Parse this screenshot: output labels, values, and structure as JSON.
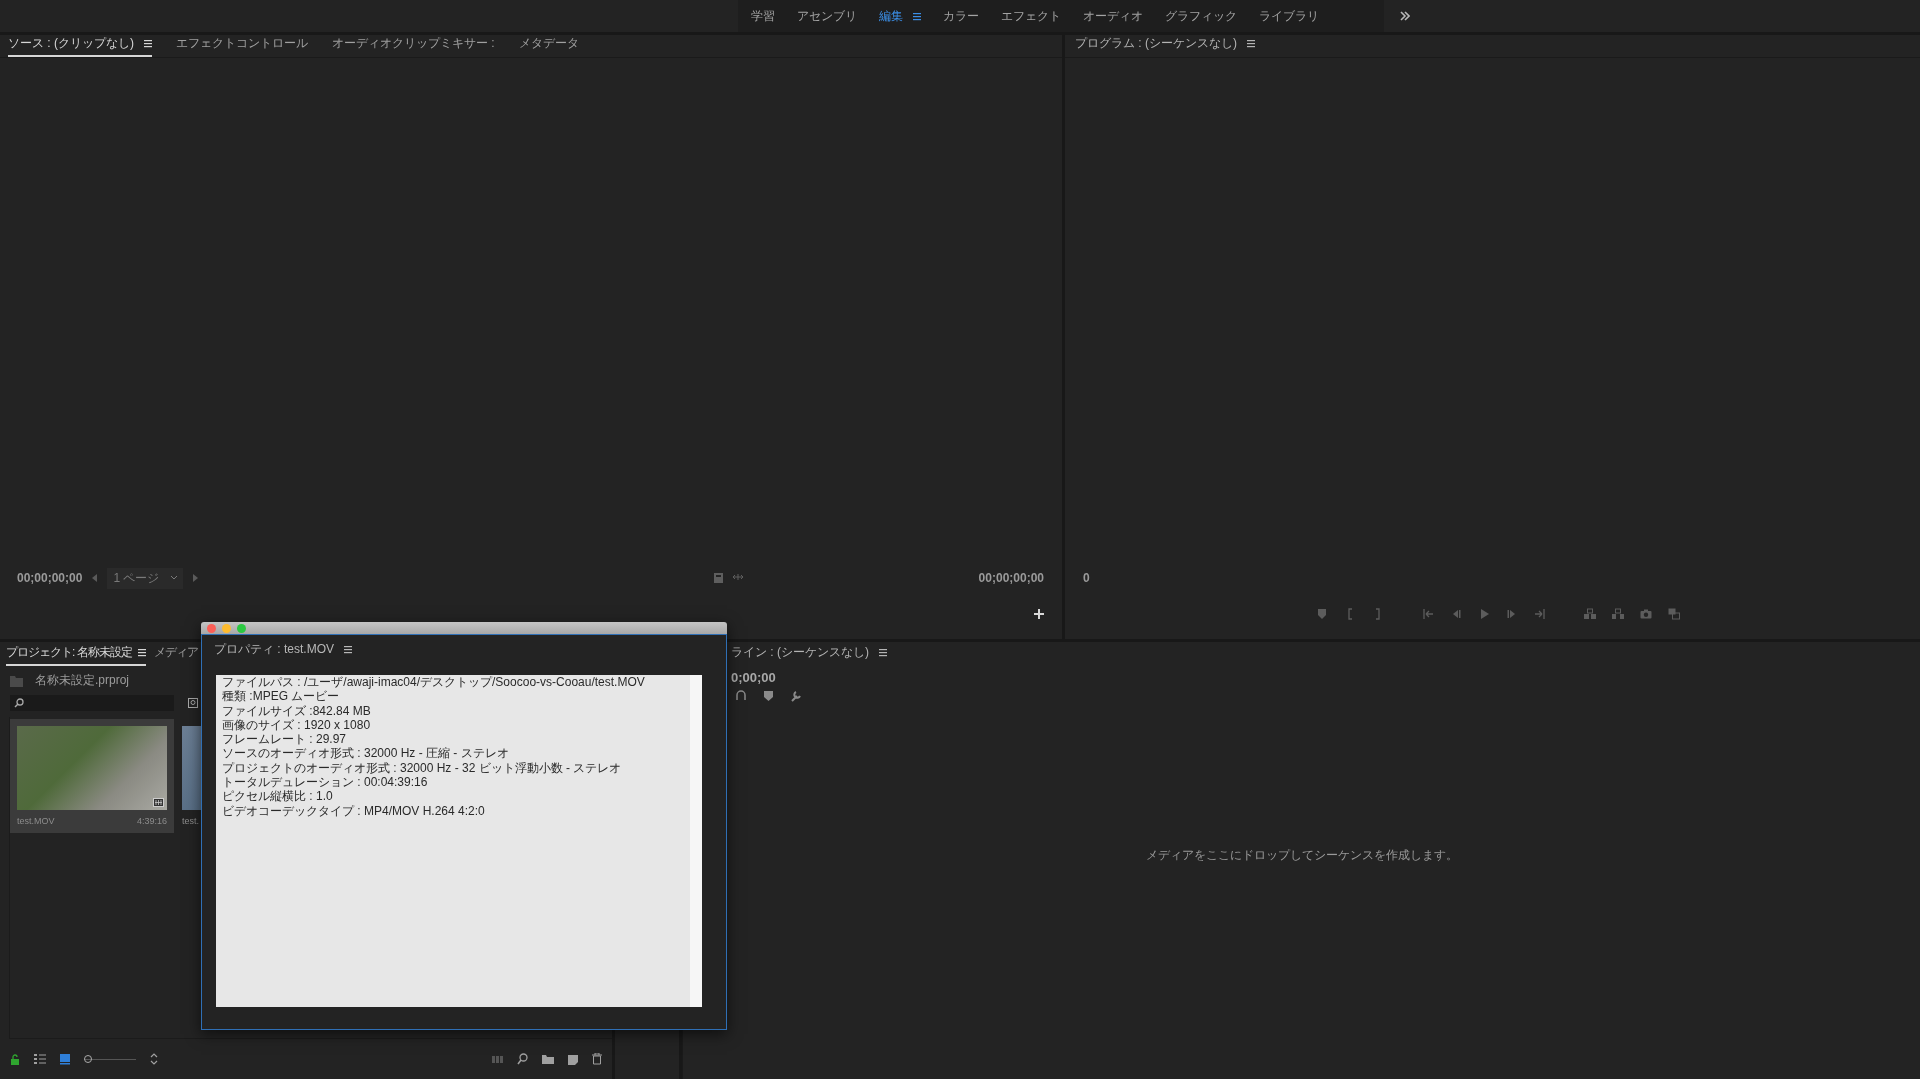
{
  "workspace_bar": {
    "tabs": [
      {
        "label": "学習",
        "selected": false
      },
      {
        "label": "アセンブリ",
        "selected": false
      },
      {
        "label": "編集",
        "selected": true
      },
      {
        "label": "カラー",
        "selected": false
      },
      {
        "label": "エフェクト",
        "selected": false
      },
      {
        "label": "オーディオ",
        "selected": false
      },
      {
        "label": "グラフィック",
        "selected": false
      },
      {
        "label": "ライブラリ",
        "selected": false
      }
    ]
  },
  "source_panel": {
    "tabs": [
      {
        "label": "ソース : (クリップなし)",
        "selected": true
      },
      {
        "label": "エフェクトコントロール",
        "selected": false
      },
      {
        "label": "オーディオクリップミキサー :",
        "selected": false
      },
      {
        "label": "メタデータ",
        "selected": false
      }
    ],
    "timecode_left": "00;00;00;00",
    "page_select": "1 ページ",
    "timecode_right": "00;00;00;00"
  },
  "program_panel": {
    "title": "プログラム : (シーケンスなし)",
    "timecode": "0"
  },
  "project_panel": {
    "tabs": [
      {
        "label": "プロジェクト: 名称未設定",
        "selected": true
      },
      {
        "label": "メディア",
        "selected": false
      }
    ],
    "project_file": "名称未設定.prproj",
    "items": [
      {
        "name": "test.MOV",
        "duration": "4:39:16",
        "selected": true
      },
      {
        "name": "test.",
        "selected": false
      }
    ],
    "thumbnail_zoom": {
      "level": 0
    }
  },
  "timeline_panel": {
    "title": "ライン : (シーケンスなし)",
    "timecode": "0;00;00",
    "empty_message": "メディアをここにドロップしてシーケンスを作成します。"
  },
  "properties_dialog": {
    "title": "プロパティ : test.MOV",
    "lines": [
      "ファイルパス : /ユーザ/awaji-imac04/デスクトップ/Soocoo-vs-Cooau/test.MOV",
      "種類 :MPEG ムービー",
      "ファイルサイズ :842.84 MB",
      "画像のサイズ : 1920 x 1080",
      "フレームレート : 29.97",
      "ソースのオーディオ形式 : 32000 Hz - 圧縮 - ステレオ",
      "プロジェクトのオーディオ形式 : 32000 Hz - 32 ビット浮動小数 - ステレオ",
      "トータルデュレーション : 00:04:39:16",
      "ピクセル縦横比 : 1.0",
      "ビデオコーデックタイプ : MP4/MOV H.264 4:2:0"
    ]
  }
}
